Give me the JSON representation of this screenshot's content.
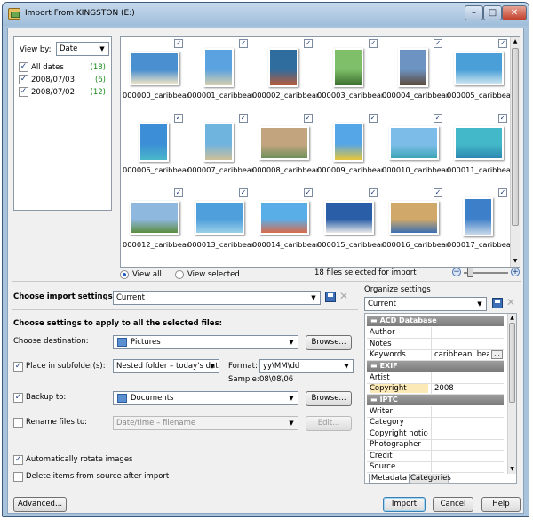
{
  "window": {
    "title": "Import From KINGSTON (E:)"
  },
  "viewby": {
    "label": "View by:",
    "value": "Date"
  },
  "dates": [
    {
      "label": "All dates",
      "count": "(18)"
    },
    {
      "label": "2008/07/03",
      "count": "(6)"
    },
    {
      "label": "2008/07/02",
      "count": "(12)"
    }
  ],
  "thumbnails": [
    {
      "name": "000000_caribbean",
      "c1": "#4a8fd0",
      "c2": "#e9e2c8"
    },
    {
      "name": "000001_caribbean",
      "c1": "#5aa3e0",
      "c2": "#d8cfae"
    },
    {
      "name": "000002_caribbean",
      "c1": "#2e6d9e",
      "c2": "#b85a3a"
    },
    {
      "name": "000003_caribbean",
      "c1": "#7fbf6a",
      "c2": "#3b6e2e"
    },
    {
      "name": "000004_caribbean",
      "c1": "#6c93c2",
      "c2": "#5c4a3a"
    },
    {
      "name": "000005_caribbean",
      "c1": "#4b9fd8",
      "c2": "#c9e4ef"
    },
    {
      "name": "000006_caribbean",
      "c1": "#3c8fd6",
      "c2": "#4ab7c9"
    },
    {
      "name": "000007_caribbean",
      "c1": "#6fb3df",
      "c2": "#cfc09a"
    },
    {
      "name": "000008_caribbean",
      "c1": "#c2a57e",
      "c2": "#6e8f5a"
    },
    {
      "name": "000009_caribbean",
      "c1": "#55a6e6",
      "c2": "#e7c63a"
    },
    {
      "name": "000010_caribbean",
      "c1": "#7bbde8",
      "c2": "#3da5b5"
    },
    {
      "name": "000011_caribbean",
      "c1": "#43b8c8",
      "c2": "#2c86b0"
    },
    {
      "name": "000012_caribbean",
      "c1": "#8fb8de",
      "c2": "#5a8c3e"
    },
    {
      "name": "000013_caribbean",
      "c1": "#4f9fdc",
      "c2": "#9ad0e8"
    },
    {
      "name": "000014_caribbean",
      "c1": "#5aaee8",
      "c2": "#d96b4a"
    },
    {
      "name": "000015_caribbean",
      "c1": "#2a5fa8",
      "c2": "#e8e8e8"
    },
    {
      "name": "000016_caribbean",
      "c1": "#cfa86a",
      "c2": "#3c6fb2"
    },
    {
      "name": "000017_caribbean",
      "c1": "#3d7fc8",
      "c2": "#c8d8e8"
    }
  ],
  "view": {
    "all": "View all",
    "selected": "View selected",
    "status": "18 files selected for import"
  },
  "import_settings": {
    "label": "Choose import settings:",
    "value": "Current"
  },
  "apply_heading": "Choose settings to apply to all the selected files:",
  "destination": {
    "label": "Choose destination:",
    "value": "Pictures",
    "browse": "Browse..."
  },
  "subfolder": {
    "label": "Place in subfolder(s):",
    "value": "Nested folder – today's date",
    "format_label": "Format:",
    "format_value": "yy\\MM\\dd",
    "sample_label": "Sample:",
    "sample_value": "08\\08\\06"
  },
  "backup": {
    "label": "Backup to:",
    "value": "Documents",
    "browse": "Browse..."
  },
  "rename": {
    "label": "Rename files to:",
    "value": "Date/time – filename",
    "edit": "Edit..."
  },
  "options": {
    "rotate": "Automatically rotate images",
    "delete": "Delete items from source after import"
  },
  "organize": {
    "label": "Organize settings",
    "value": "Current"
  },
  "metadata": {
    "categories": [
      {
        "name": "ACD Database",
        "rows": [
          {
            "k": "Author",
            "v": ""
          },
          {
            "k": "Notes",
            "v": ""
          },
          {
            "k": "Keywords",
            "v": "caribbean, beac..."
          }
        ]
      },
      {
        "name": "EXIF",
        "rows": [
          {
            "k": "Artist",
            "v": ""
          },
          {
            "k": "Copyright",
            "v": "2008"
          }
        ]
      },
      {
        "name": "IPTC",
        "rows": [
          {
            "k": "Writer",
            "v": ""
          },
          {
            "k": "Category",
            "v": ""
          },
          {
            "k": "Copyright notice",
            "v": ""
          },
          {
            "k": "Photographer",
            "v": ""
          },
          {
            "k": "Credit",
            "v": ""
          },
          {
            "k": "Source",
            "v": ""
          }
        ]
      }
    ],
    "tabs": [
      "Metadata",
      "Categories"
    ],
    "ellipsis": "..."
  },
  "buttons": {
    "advanced": "Advanced...",
    "import": "Import",
    "cancel": "Cancel",
    "help": "Help"
  },
  "caption": {
    "min": "–",
    "max": "□",
    "close": "✕"
  }
}
